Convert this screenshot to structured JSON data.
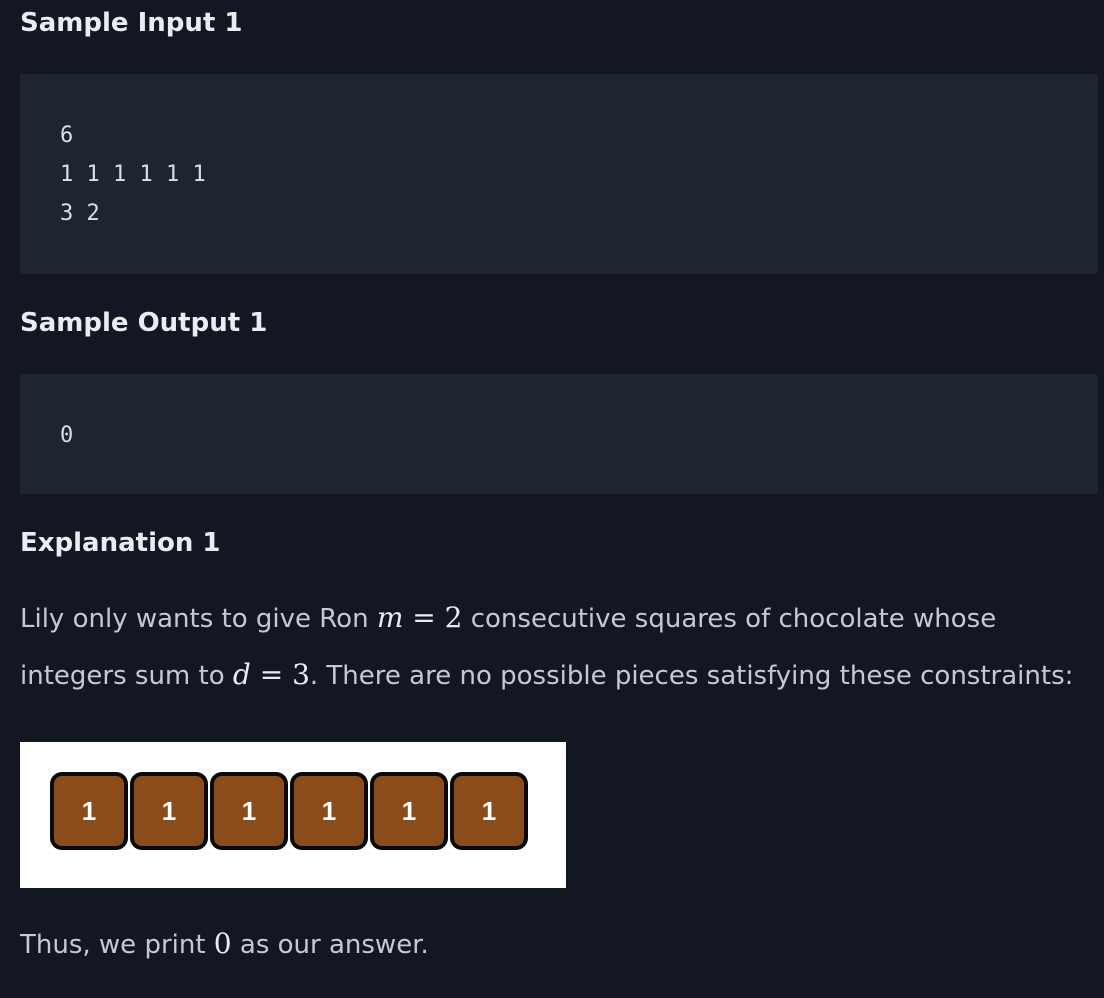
{
  "sample_input": {
    "heading": "Sample Input 1",
    "lines": [
      "6",
      "1 1 1 1 1 1",
      "3 2"
    ]
  },
  "sample_output": {
    "heading": "Sample Output 1",
    "lines": [
      "0"
    ]
  },
  "explanation": {
    "heading": "Explanation 1",
    "text_part1": "Lily only wants to give Ron ",
    "math_m_var": "m",
    "math_eq1": " = 2",
    "text_part2": " consecutive squares of chocolate whose",
    "text_part3": "integers sum to ",
    "math_d_var": "d",
    "math_eq2": " = 3",
    "text_part4": ". There are no possible pieces satisfying these constraints:",
    "chocolate_squares": [
      "1",
      "1",
      "1",
      "1",
      "1",
      "1"
    ],
    "conclusion_part1": "Thus, we print ",
    "conclusion_math": "0",
    "conclusion_part2": " as our answer."
  },
  "colors": {
    "page_background": "#131722",
    "code_background": "#1f2431",
    "chocolate": "#8b4c1c"
  }
}
